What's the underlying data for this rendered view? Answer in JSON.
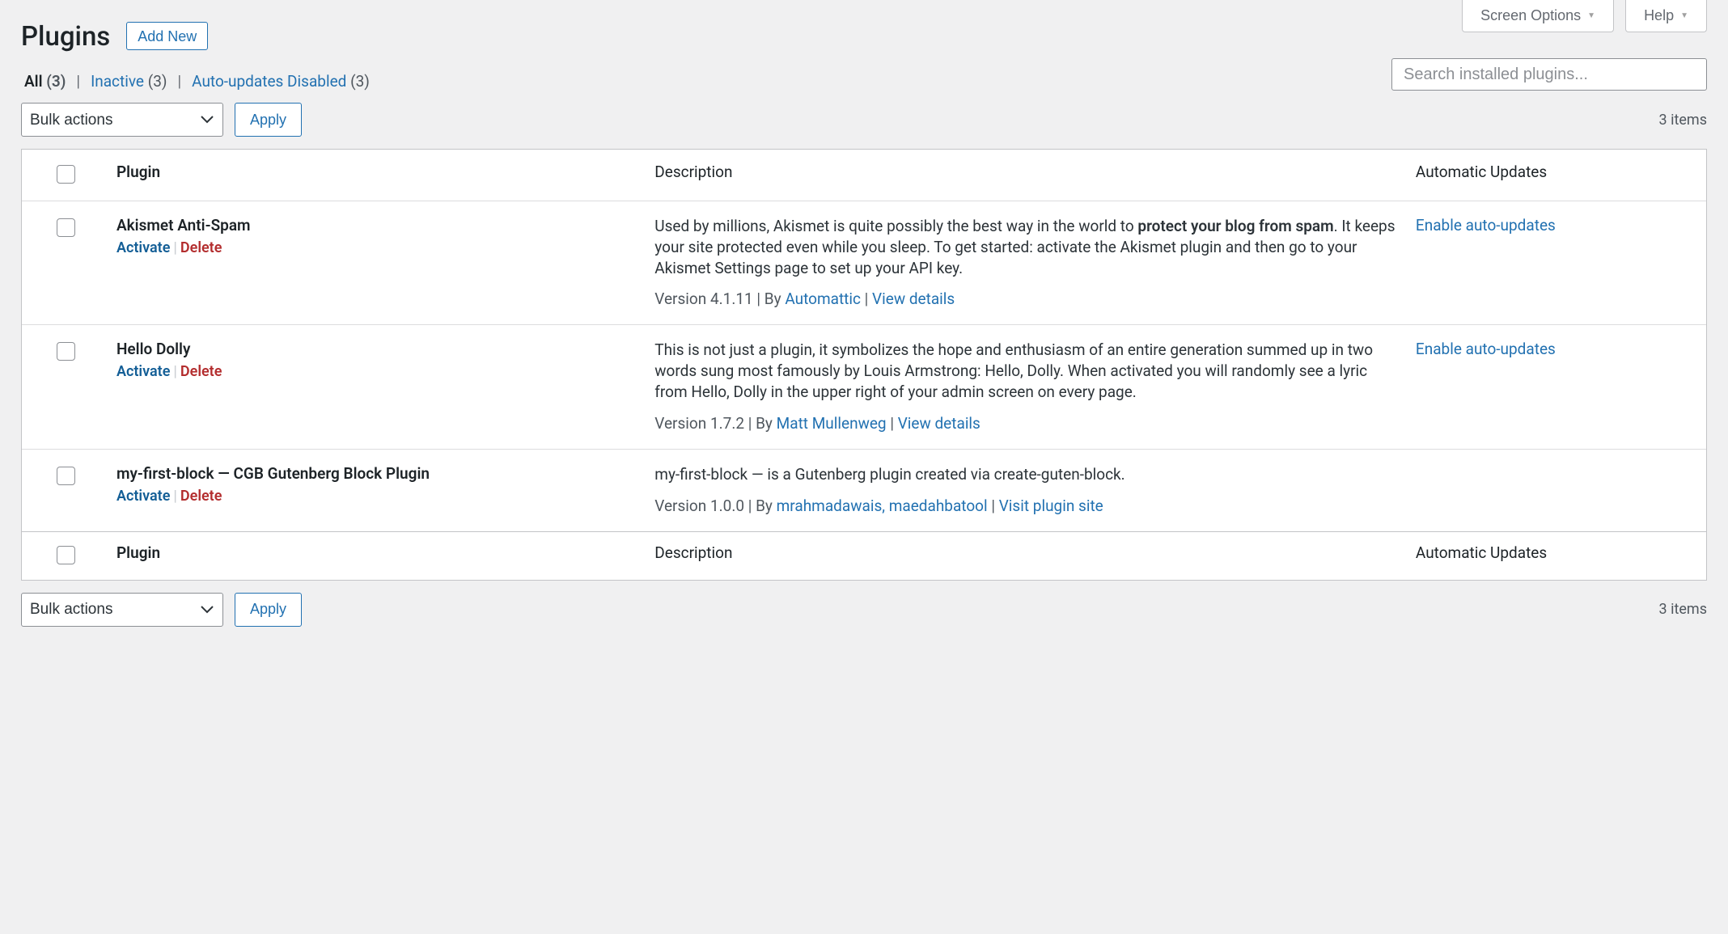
{
  "topButtons": {
    "screenOptions": "Screen Options",
    "help": "Help"
  },
  "page": {
    "title": "Plugins",
    "addNew": "Add New"
  },
  "filters": {
    "all": {
      "label": "All",
      "count": "(3)"
    },
    "inactive": {
      "label": "Inactive",
      "count": "(3)"
    },
    "autoDisabled": {
      "label": "Auto-updates Disabled",
      "count": "(3)"
    }
  },
  "search": {
    "placeholder": "Search installed plugins..."
  },
  "bulk": {
    "label": "Bulk actions",
    "apply": "Apply",
    "itemsCount": "3 items"
  },
  "columns": {
    "plugin": "Plugin",
    "description": "Description",
    "auto": "Automatic Updates"
  },
  "rowActions": {
    "activate": "Activate",
    "delete": "Delete"
  },
  "autoUpdate": {
    "enable": "Enable auto-updates"
  },
  "meta": {
    "by": "By",
    "viewDetails": "View details",
    "visitSite": "Visit plugin site"
  },
  "plugins": [
    {
      "name": "Akismet Anti-Spam",
      "desc_pre": "Used by millions, Akismet is quite possibly the best way in the world to ",
      "desc_bold": "protect your blog from spam",
      "desc_post": ". It keeps your site protected even while you sleep. To get started: activate the Akismet plugin and then go to your Akismet Settings page to set up your API key.",
      "version": "Version 4.1.11",
      "author": "Automattic",
      "extra": "view",
      "showAuto": true
    },
    {
      "name": "Hello Dolly",
      "desc_pre": "This is not just a plugin, it symbolizes the hope and enthusiasm of an entire generation summed up in two words sung most famously by Louis Armstrong: Hello, Dolly. When activated you will randomly see a lyric from Hello, Dolly in the upper right of your admin screen on every page.",
      "desc_bold": "",
      "desc_post": "",
      "version": "Version 1.7.2",
      "author": "Matt Mullenweg",
      "extra": "view",
      "showAuto": true
    },
    {
      "name": "my-first-block — CGB Gutenberg Block Plugin",
      "desc_pre": "my-first-block — is a Gutenberg plugin created via create-guten-block.",
      "desc_bold": "",
      "desc_post": "",
      "version": "Version 1.0.0",
      "author": "mrahmadawais, maedahbatool",
      "extra": "visit",
      "showAuto": false
    }
  ]
}
